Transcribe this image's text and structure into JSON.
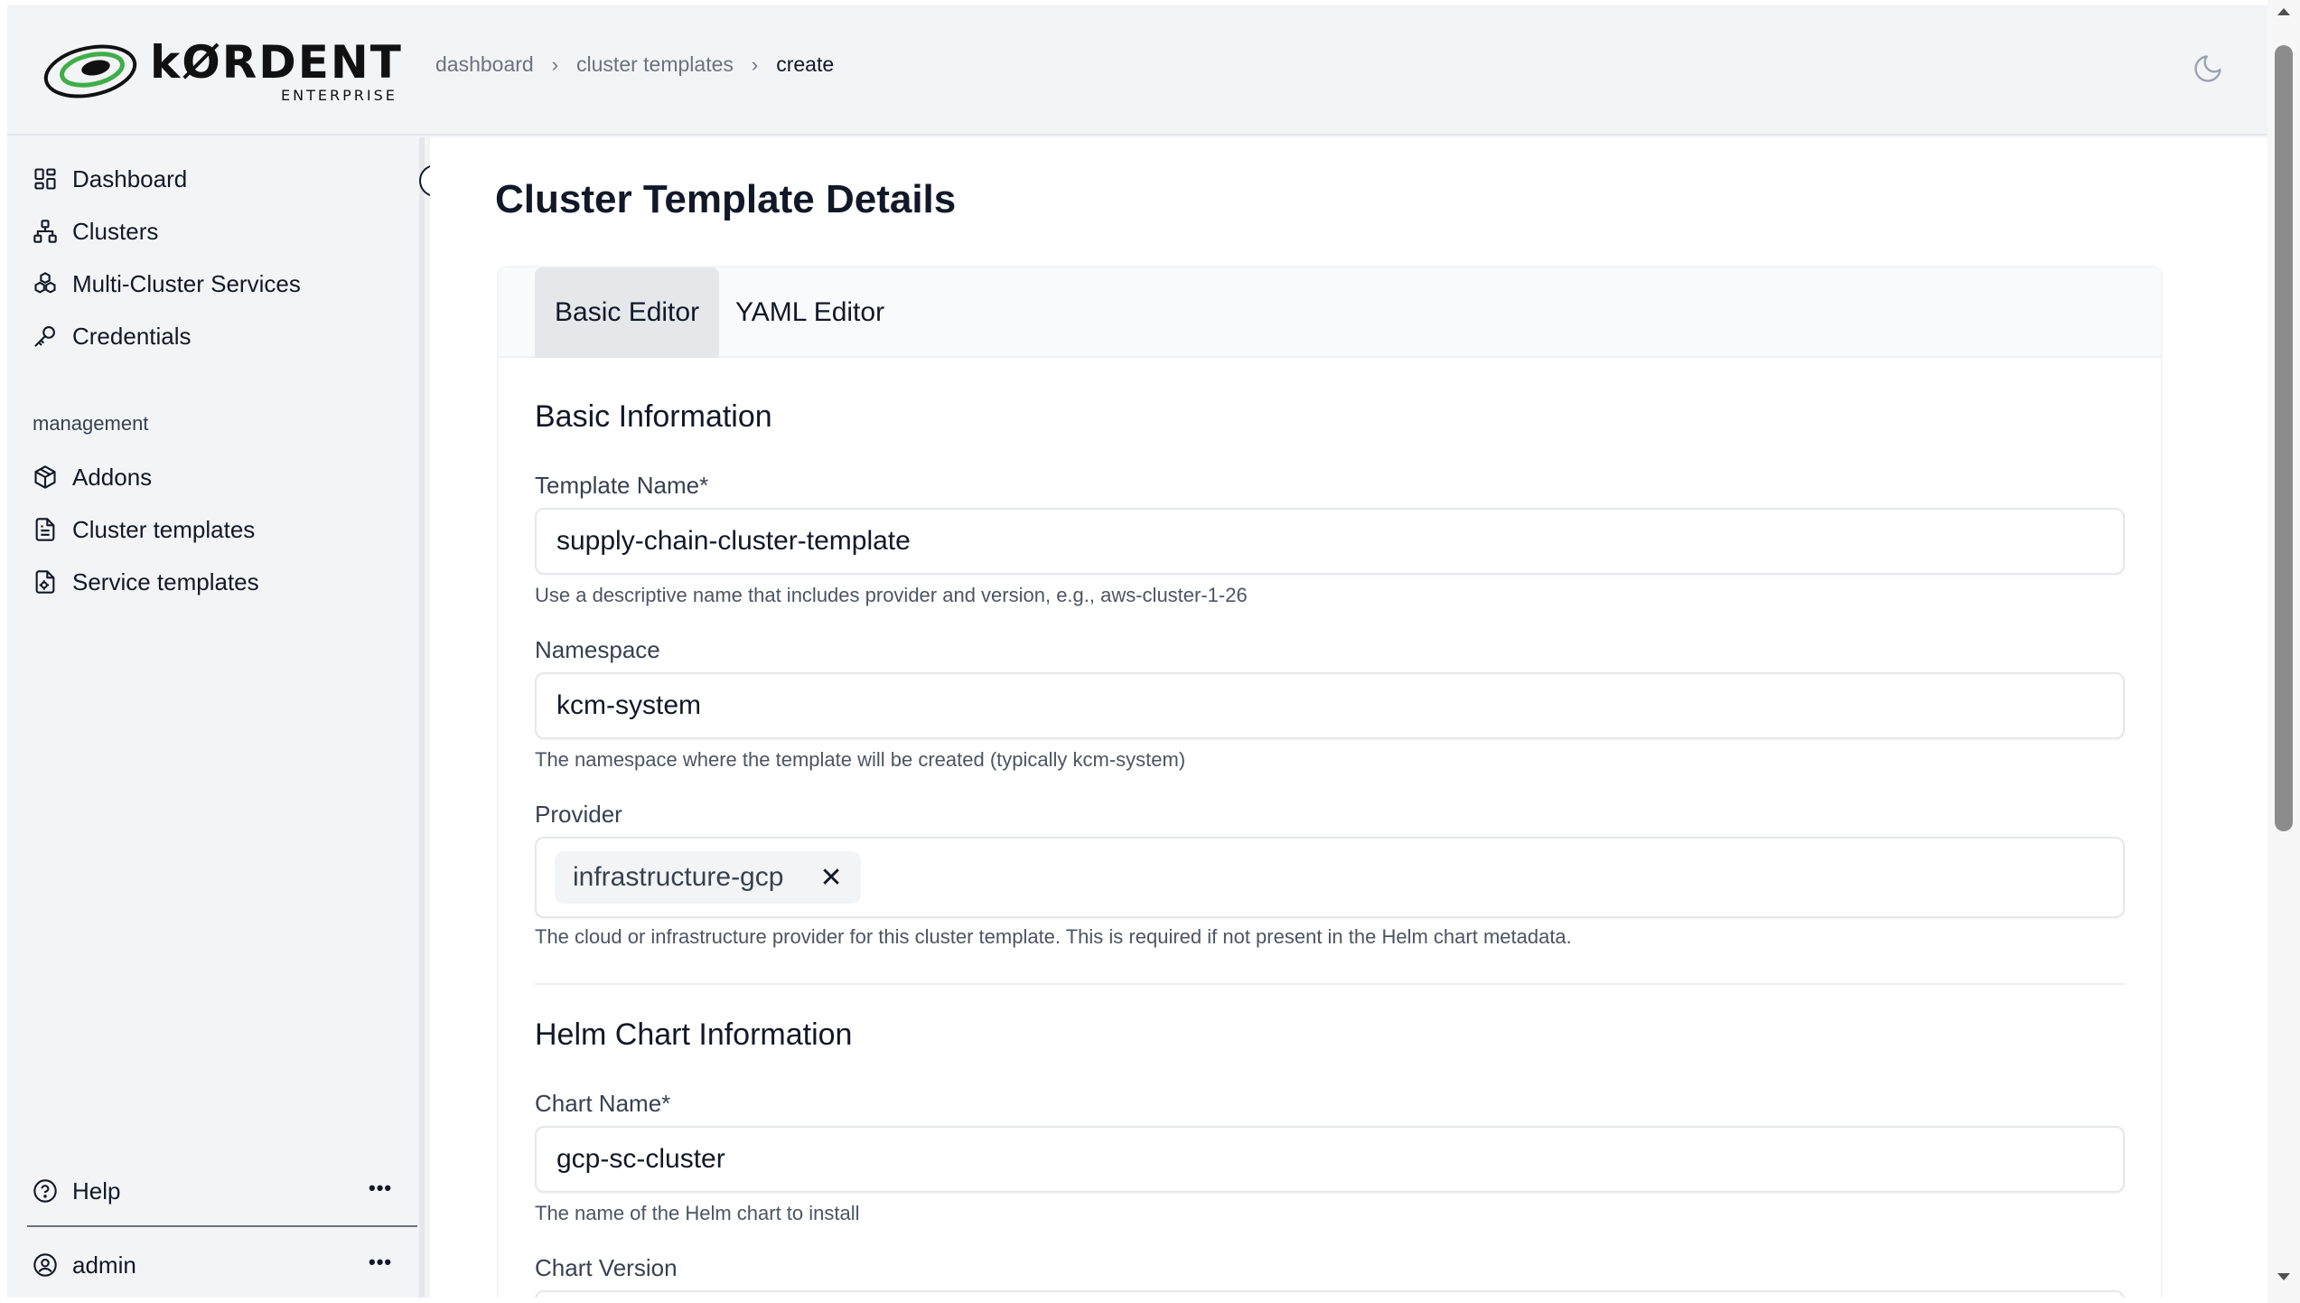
{
  "app": {
    "logo_word": "kØRDENT",
    "logo_sub": "ENTERPRISE"
  },
  "breadcrumb": [
    "dashboard",
    "cluster templates",
    "create"
  ],
  "sidebar": {
    "items": [
      {
        "label": "Dashboard",
        "icon": "dashboard-grid-icon"
      },
      {
        "label": "Clusters",
        "icon": "clusters-network-icon"
      },
      {
        "label": "Multi-Cluster Services",
        "icon": "multi-cluster-icon"
      },
      {
        "label": "Credentials",
        "icon": "key-icon"
      }
    ],
    "section_label": "management",
    "management_items": [
      {
        "label": "Addons",
        "icon": "package-icon"
      },
      {
        "label": "Cluster templates",
        "icon": "file-text-icon"
      },
      {
        "label": "Service templates",
        "icon": "file-settings-icon"
      }
    ],
    "footer": {
      "help_label": "Help",
      "user_label": "admin",
      "more_glyph": "•••"
    }
  },
  "main": {
    "title": "Cluster Template Details",
    "tabs": [
      {
        "label": "Basic Editor",
        "active": true
      },
      {
        "label": "YAML Editor",
        "active": false
      }
    ],
    "basic_info": {
      "title": "Basic Information",
      "template_name": {
        "label": "Template Name*",
        "value": "supply-chain-cluster-template",
        "hint": "Use a descriptive name that includes provider and version, e.g., aws-cluster-1-26"
      },
      "namespace": {
        "label": "Namespace",
        "value": "kcm-system",
        "hint": "The namespace where the template will be created (typically kcm-system)"
      },
      "provider": {
        "label": "Provider",
        "chip": "infrastructure-gcp",
        "remove_glyph": "✕",
        "hint": "The cloud or infrastructure provider for this cluster template. This is required if not present in the Helm chart metadata."
      }
    },
    "helm_info": {
      "title": "Helm Chart Information",
      "chart_name": {
        "label": "Chart Name*",
        "value": "gcp-sc-cluster",
        "hint": "The name of the Helm chart to install"
      },
      "chart_version": {
        "label": "Chart Version"
      }
    }
  },
  "colors": {
    "accent_green": "#3fae49",
    "sidebar_bg": "#f3f4f6",
    "text": "#111827"
  }
}
